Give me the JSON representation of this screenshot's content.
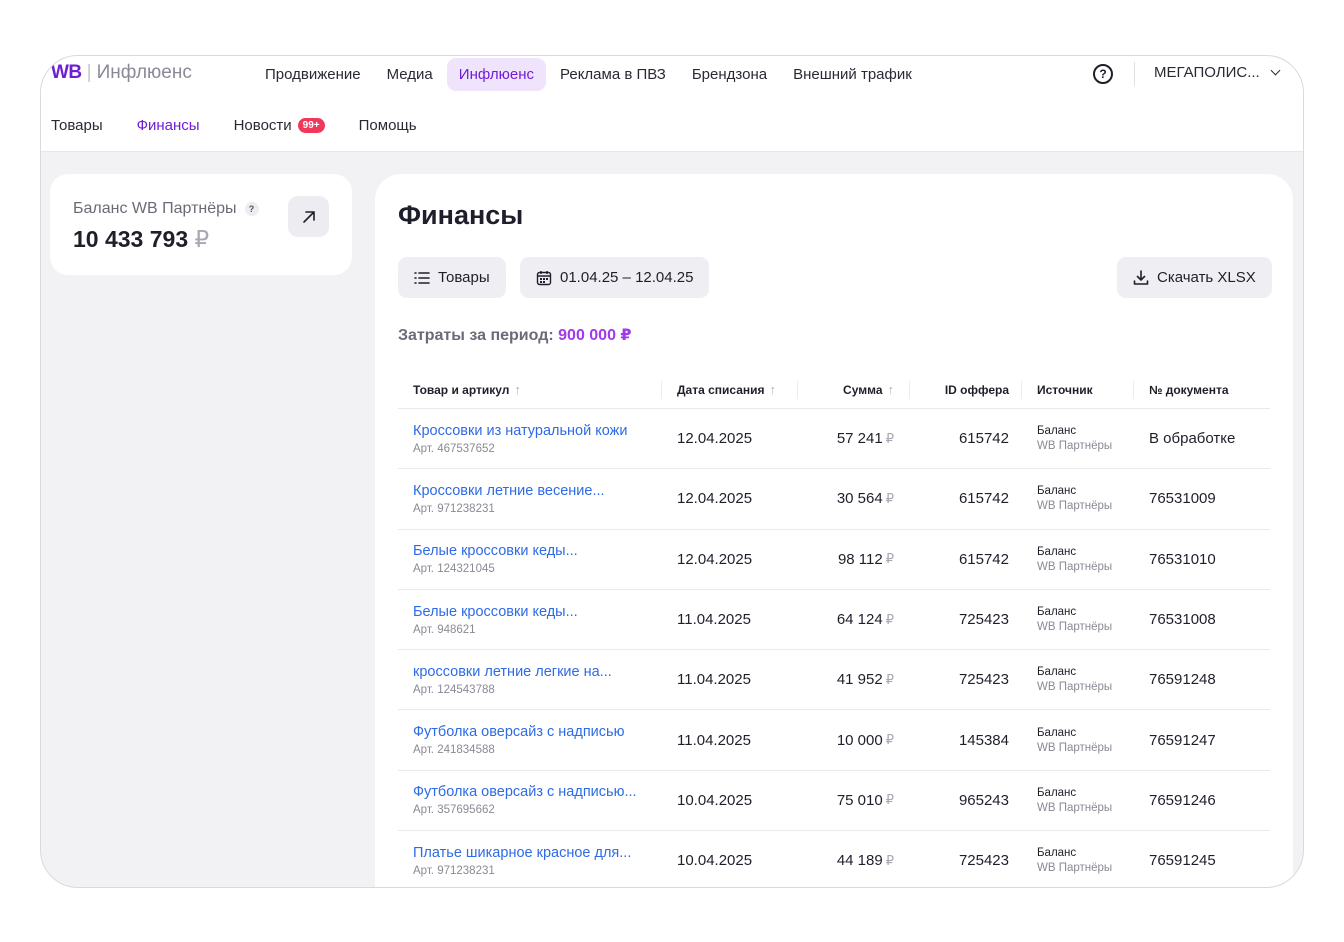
{
  "brand": {
    "logo_main": "WB",
    "logo_separator": "|",
    "logo_product": "Инфлюенс"
  },
  "main_nav": [
    {
      "label": "Продвижение",
      "active": false
    },
    {
      "label": "Медиа",
      "active": false
    },
    {
      "label": "Инфлюенс",
      "active": true
    },
    {
      "label": "Реклама в ПВЗ",
      "active": false
    },
    {
      "label": "Брендзона",
      "active": false
    },
    {
      "label": "Внешний трафик",
      "active": false
    }
  ],
  "account": {
    "name": "МЕГАПОЛИС...",
    "help_icon": "?"
  },
  "sub_nav": {
    "goods": "Товары",
    "finance": "Финансы",
    "news": "Новости",
    "news_badge": "99+",
    "help": "Помощь"
  },
  "balance": {
    "label": "Баланс WB Партнёры",
    "hint": "?",
    "value": "10 433 793",
    "currency": "₽"
  },
  "page": {
    "title": "Финансы",
    "goods_button": "Товары",
    "date_range": "01.04.25 – 12.04.25",
    "download_button": "Скачать XLSX",
    "spent_label": "Затраты за период:",
    "spent_value": "900 000 ₽"
  },
  "table": {
    "columns": {
      "product": "Товар и артикул",
      "date": "Дата списания",
      "sum": "Сумма",
      "offer_id": "ID оффера",
      "source": "Источник",
      "doc": "№ документа"
    },
    "currency": "₽",
    "rows": [
      {
        "name": "Кроссовки из натуральной кожи",
        "art": "Арт. 467537652",
        "date": "12.04.2025",
        "sum": "57 241",
        "offer": "615742",
        "src1": "Баланс",
        "src2": "WB Партнёры",
        "doc": "В обработке"
      },
      {
        "name": "Кроссовки летние весение...",
        "art": "Арт. 971238231",
        "date": "12.04.2025",
        "sum": "30 564",
        "offer": "615742",
        "src1": "Баланс",
        "src2": "WB Партнёры",
        "doc": "76531009"
      },
      {
        "name": "Белые кроссовки кеды...",
        "art": "Арт. 124321045",
        "date": "12.04.2025",
        "sum": "98 112",
        "offer": "615742",
        "src1": "Баланс",
        "src2": "WB Партнёры",
        "doc": "76531010"
      },
      {
        "name": "Белые кроссовки кеды...",
        "art": "Арт. 948621",
        "date": "11.04.2025",
        "sum": "64 124",
        "offer": "725423",
        "src1": "Баланс",
        "src2": "WB Партнёры",
        "doc": "76531008"
      },
      {
        "name": "кроссовки летние легкие на...",
        "art": "Арт. 124543788",
        "date": "11.04.2025",
        "sum": "41 952",
        "offer": "725423",
        "src1": "Баланс",
        "src2": "WB Партнёры",
        "doc": "76591248"
      },
      {
        "name": "Футболка оверсайз с надписью",
        "art": "Арт. 241834588",
        "date": "11.04.2025",
        "sum": "10 000",
        "offer": "145384",
        "src1": "Баланс",
        "src2": "WB Партнёры",
        "doc": "76591247"
      },
      {
        "name": "Футболка оверсайз с надписью...",
        "art": "Арт. 357695662",
        "date": "10.04.2025",
        "sum": "75 010",
        "offer": "965243",
        "src1": "Баланс",
        "src2": "WB Партнёры",
        "doc": "76591246"
      },
      {
        "name": "Платье шикарное красное для...",
        "art": "Арт. 971238231",
        "date": "10.04.2025",
        "sum": "44 189",
        "offer": "725423",
        "src1": "Баланс",
        "src2": "WB Партнёры",
        "doc": "76591245"
      }
    ]
  }
}
